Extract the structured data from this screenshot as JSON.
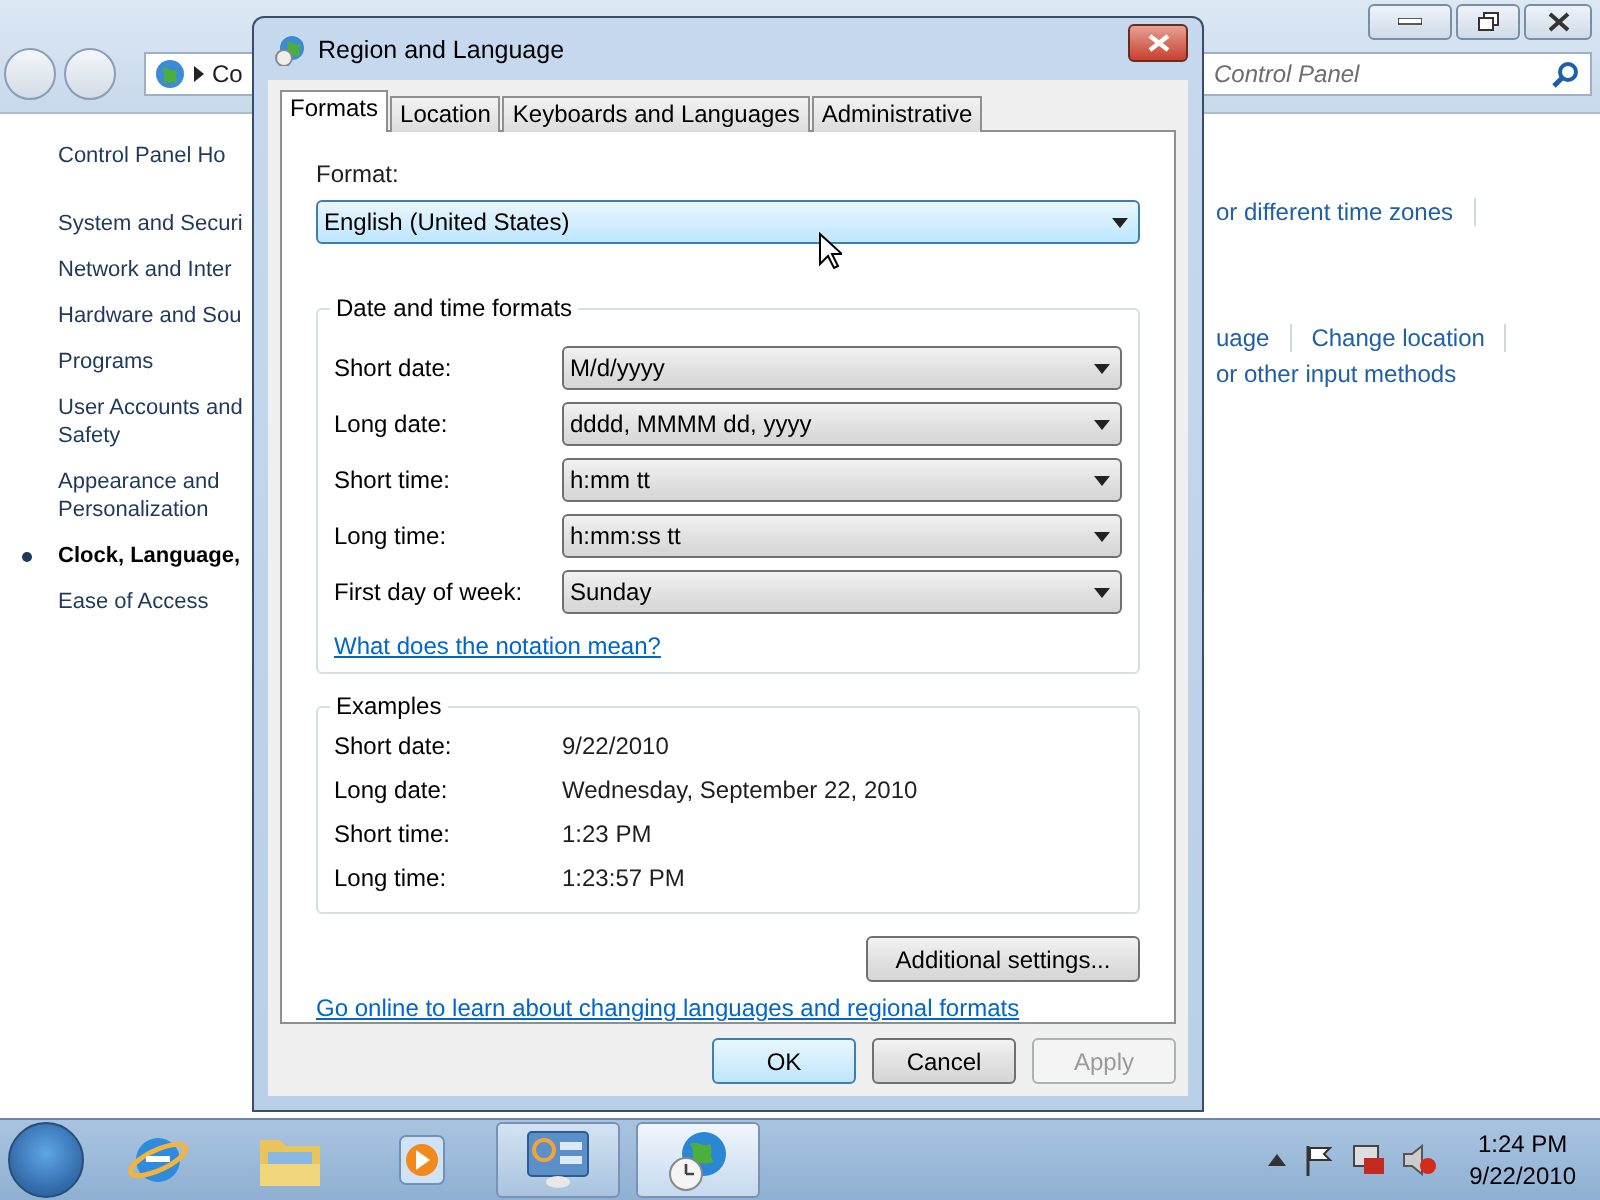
{
  "control_panel": {
    "address": "Co",
    "search": {
      "placeholder": "Control Panel"
    },
    "sidebar": [
      {
        "label": "Control Panel Ho",
        "selected": false
      },
      {
        "label": "System and Securi",
        "selected": false
      },
      {
        "label": "Network and Inter",
        "selected": false
      },
      {
        "label": "Hardware and Sou",
        "selected": false
      },
      {
        "label": "Programs",
        "selected": false
      },
      {
        "label": "User Accounts and Safety",
        "selected": false
      },
      {
        "label": "Appearance and Personalization",
        "selected": false
      },
      {
        "label": "Clock, Language,",
        "selected": true
      },
      {
        "label": "Ease of Access",
        "selected": false
      }
    ],
    "link_rows": [
      [
        {
          "text": "or different time zones"
        }
      ],
      [
        {
          "text": "uage"
        },
        {
          "text": "Change location"
        }
      ],
      [
        {
          "text": "or other input methods"
        }
      ]
    ]
  },
  "dialog": {
    "title": "Region and Language",
    "tabs": [
      {
        "label": "Formats",
        "selected": true
      },
      {
        "label": "Location",
        "selected": false
      },
      {
        "label": "Keyboards and Languages",
        "selected": false
      },
      {
        "label": "Administrative",
        "selected": false
      }
    ],
    "format_label": "Format:",
    "format_value": "English (United States)",
    "formats_group": {
      "title": "Date and time formats",
      "rows": [
        {
          "label": "Short date:",
          "value": "M/d/yyyy"
        },
        {
          "label": "Long date:",
          "value": "dddd, MMMM dd, yyyy"
        },
        {
          "label": "Short time:",
          "value": "h:mm tt"
        },
        {
          "label": "Long time:",
          "value": "h:mm:ss tt"
        },
        {
          "label": "First day of week:",
          "value": "Sunday"
        }
      ]
    },
    "notation_link": "What does the notation mean?",
    "examples_group": {
      "title": "Examples",
      "rows": [
        {
          "label": "Short date:",
          "value": "9/22/2010"
        },
        {
          "label": "Long date:",
          "value": "Wednesday, September 22, 2010"
        },
        {
          "label": "Short time:",
          "value": "1:23 PM"
        },
        {
          "label": "Long time:",
          "value": "1:23:57 PM"
        }
      ]
    },
    "additional_button": "Additional settings...",
    "online_link": "Go online to learn about changing languages and regional formats",
    "buttons": [
      {
        "label": "OK",
        "kind": "default",
        "disabled": false
      },
      {
        "label": "Cancel",
        "kind": "normal",
        "disabled": false
      },
      {
        "label": "Apply",
        "kind": "normal",
        "disabled": true
      }
    ]
  },
  "taskbar": {
    "apps": [
      {
        "kind": "browser",
        "open": false,
        "selected": false
      },
      {
        "kind": "folder",
        "open": false,
        "selected": false
      },
      {
        "kind": "media",
        "open": false,
        "selected": false
      },
      {
        "kind": "control-panel",
        "open": true,
        "selected": false
      },
      {
        "kind": "globe",
        "open": true,
        "selected": true
      }
    ],
    "time": "1:24 PM",
    "date": "9/22/2010"
  }
}
